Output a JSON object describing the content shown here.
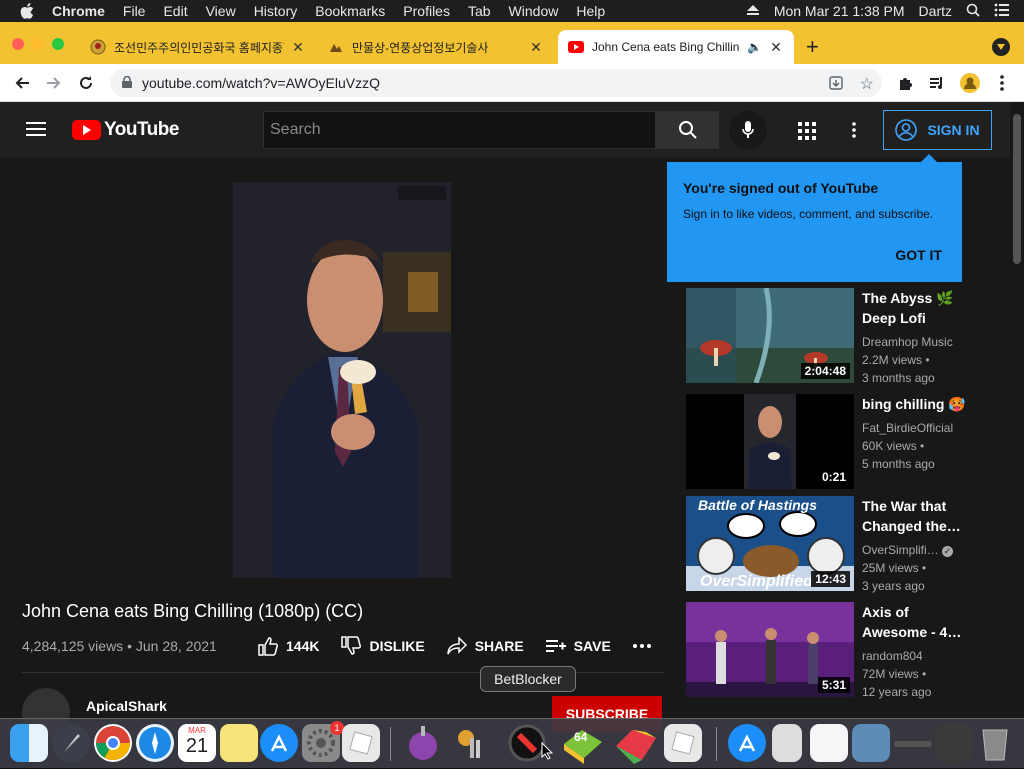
{
  "menubar": {
    "app": "Chrome",
    "items": [
      "File",
      "Edit",
      "View",
      "History",
      "Bookmarks",
      "Profiles",
      "Tab",
      "Window",
      "Help"
    ],
    "datetime": "Mon Mar 21  1:38 PM",
    "user": "Dartz"
  },
  "tabs": [
    {
      "title": "조선민주주의인민공화국 홈페지종합"
    },
    {
      "title": "만물상-연풍상업정보기술사"
    },
    {
      "title": "John Cena eats Bing Chillin"
    }
  ],
  "omnibox": {
    "url": "youtube.com/watch?v=AWOyEluVzzQ"
  },
  "youtube": {
    "logo_text": "YouTube",
    "search_placeholder": "Search",
    "signin_label": "SIGN IN"
  },
  "popup": {
    "title": "You're signed out of YouTube",
    "body": "Sign in to like videos, comment, and subscribe.",
    "button": "GOT IT"
  },
  "video": {
    "title": "John Cena eats Bing Chilling (1080p) (CC)",
    "views": "4,284,125 views",
    "date": "Jun 28, 2021",
    "likes": "144K",
    "dislike": "DISLIKE",
    "share": "SHARE",
    "save": "SAVE",
    "channel": "ApicalShark",
    "subscribe": "SUBSCRIBE"
  },
  "recommendations": [
    {
      "title": "The Abyss 🌿 Deep Lofi Beats",
      "channel": "Dreamhop Music",
      "views": "2.2M views •",
      "age": "3 months ago",
      "duration": "2:04:48"
    },
    {
      "title": "bing chilling 🥵",
      "channel": "Fat_BirdieOfficial",
      "views": "60K views •",
      "age": "5 months ago",
      "duration": "0:21"
    },
    {
      "title": "The War that Changed the…",
      "channel": "OverSimplifi…",
      "views": "25M views •",
      "age": "3 years ago",
      "duration": "12:43",
      "thumb_caption": "Battle of Hastings",
      "thumb_brand": "OverSimplified"
    },
    {
      "title": "Axis of Awesome - 4…",
      "channel": "random804",
      "views": "72M views •",
      "age": "12 years ago",
      "duration": "5:31"
    }
  ],
  "dock": {
    "tooltip": "BetBlocker",
    "calendar_month": "MAR",
    "calendar_day": "21",
    "badge": "1",
    "bluestacks_label": "64"
  },
  "colors": {
    "yt_red": "#ff0000",
    "popup_blue": "#2196f3",
    "tabstrip": "#f2c230",
    "link_blue": "#3ea6ff"
  }
}
